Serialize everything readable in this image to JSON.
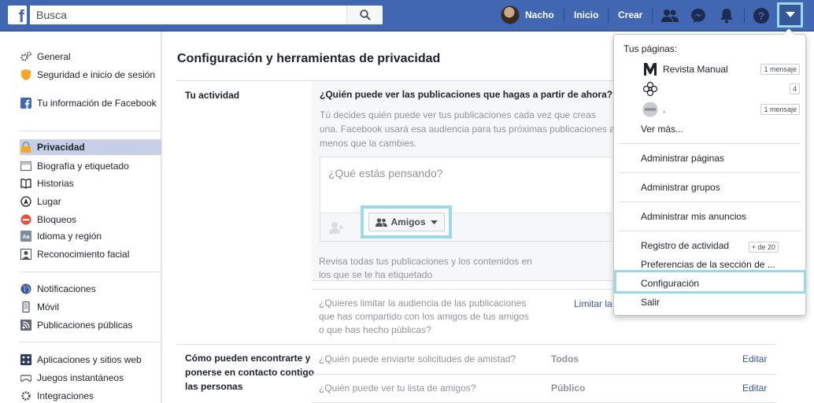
{
  "topbar": {
    "logo": "f",
    "search_placeholder": "Busca",
    "user_name": "Nacho",
    "home": "Inicio",
    "create": "Crear"
  },
  "leftnav": {
    "items": [
      {
        "label": "General",
        "icon": "gear-icon"
      },
      {
        "label": "Seguridad e inicio de sesión",
        "icon": "shield-icon"
      },
      {
        "label": "Tu información de Facebook",
        "icon": "facebook-icon"
      },
      {
        "label": "Privacidad",
        "icon": "lock-icon"
      },
      {
        "label": "Biografía y etiquetado",
        "icon": "timeline-icon"
      },
      {
        "label": "Historias",
        "icon": "book-icon"
      },
      {
        "label": "Lugar",
        "icon": "location-icon"
      },
      {
        "label": "Bloqueos",
        "icon": "block-icon"
      },
      {
        "label": "Idioma y región",
        "icon": "language-icon"
      },
      {
        "label": "Reconocimiento facial",
        "icon": "face-icon"
      },
      {
        "label": "Notificaciones",
        "icon": "globe-icon"
      },
      {
        "label": "Móvil",
        "icon": "mobile-icon"
      },
      {
        "label": "Publicaciones públicas",
        "icon": "rss-icon"
      },
      {
        "label": "Aplicaciones y sitios web",
        "icon": "apps-icon"
      },
      {
        "label": "Juegos instantáneos",
        "icon": "gamepad-icon"
      },
      {
        "label": "Integraciones",
        "icon": "gear-icon"
      }
    ]
  },
  "main": {
    "title": "Configuración y herramientas de privacidad",
    "activity_label": "Tu actividad",
    "question1": "¿Quién puede ver las publicaciones que hagas a partir de ahora?",
    "question1_desc": "Tú decides quién puede ver tus publicaciones cada vez que creas una. Facebook usará esa audiencia para tus próximas publicaciones a menos que la cambies.",
    "composer_placeholder": "¿Qué estás pensando?",
    "audience_button": "Amigos",
    "review_text": "Revisa todas tus publicaciones y los contenidos en los que se te ha etiquetado",
    "limit_text": "¿Quieres limitar la audiencia de las publicaciones que has compartido con los amigos de tus amigos o que has hecho públicas?",
    "limit_link": "Limitar la",
    "find_label": "Cómo pueden encontrarte y ponerse en contacto contigo las personas",
    "friend_requests_q": "¿Quién puede enviarte solicitudes de amistad?",
    "friend_requests_v": "Todos",
    "friend_list_q": "¿Quién puede ver tu lista de amigos?",
    "friend_list_v": "Público",
    "edit": "Editar"
  },
  "dropdown": {
    "header": "Tus páginas:",
    "pages": [
      {
        "name": "Revista Manual",
        "badge": "1 mensaje"
      },
      {
        "name": "",
        "badge": "4"
      },
      {
        "name": ".",
        "badge": "1 mensaje"
      }
    ],
    "see_more": "Ver más...",
    "manage_pages": "Administrar páginas",
    "manage_groups": "Administrar grupos",
    "manage_ads": "Administrar mis anuncios",
    "activity_log": "Registro de actividad",
    "activity_badge": "+ de 20",
    "news_prefs": "Preferencias de la sección de ...",
    "settings": "Configuración",
    "logout": "Salir"
  },
  "colors": {
    "brand": "#4267b2",
    "highlight": "#9ad8ea",
    "active_nav": "#c5d0e6",
    "link": "#365899"
  }
}
